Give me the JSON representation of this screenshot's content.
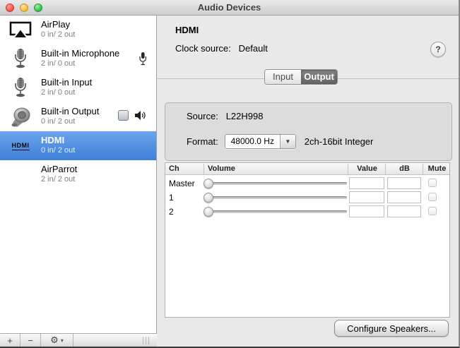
{
  "window": {
    "title": "Audio Devices"
  },
  "sidebar": {
    "items": [
      {
        "name": "AirPlay",
        "detail": "0 in/ 2 out",
        "icon": "airplay-icon",
        "selected": false
      },
      {
        "name": "Built-in Microphone",
        "detail": "2 in/ 0 out",
        "icon": "microphone-icon",
        "badges": [
          "default-input-mic-icon"
        ],
        "selected": false
      },
      {
        "name": "Built-in Input",
        "detail": "2 in/ 0 out",
        "icon": "microphone-icon",
        "selected": false
      },
      {
        "name": "Built-in Output",
        "detail": "0 in/ 2 out",
        "icon": "speaker-icon",
        "badges": [
          "system-sounds-finder-icon",
          "default-output-speaker-icon"
        ],
        "selected": false
      },
      {
        "name": "HDMI",
        "detail": "0 in/ 2 out",
        "icon": "hdmi-wordmark",
        "icon_text": "HDMI",
        "selected": true
      },
      {
        "name": "AirParrot",
        "detail": "2 in/ 2 out",
        "icon": null,
        "selected": false
      }
    ],
    "toolbar": {
      "add_label": "+",
      "remove_label": "−",
      "gear_glyph": "⚙",
      "caret_glyph": "▾"
    },
    "selection_color": "#4d8bdf"
  },
  "main": {
    "device_title": "HDMI",
    "clock_source_label": "Clock source:",
    "clock_source_value": "Default",
    "help_label": "?",
    "tabs": [
      {
        "label": "Input",
        "active": false
      },
      {
        "label": "Output",
        "active": true
      }
    ],
    "source_label": "Source:",
    "source_value": "L22H998",
    "format_label": "Format:",
    "format_value": "48000.0 Hz",
    "dropdown_arrow_glyph": "▼",
    "format_detail": "2ch-16bit Integer",
    "configure_button": "Configure Speakers..."
  },
  "channels_table": {
    "headers": [
      "Ch",
      "Volume",
      "Value",
      "dB",
      "Mute"
    ],
    "rows": [
      {
        "ch": "Master",
        "volume_position": 0,
        "value": "",
        "db": "",
        "mute": false
      },
      {
        "ch": "1",
        "volume_position": 0,
        "value": "",
        "db": "",
        "mute": false
      },
      {
        "ch": "2",
        "volume_position": 0,
        "value": "",
        "db": "",
        "mute": false
      }
    ]
  }
}
